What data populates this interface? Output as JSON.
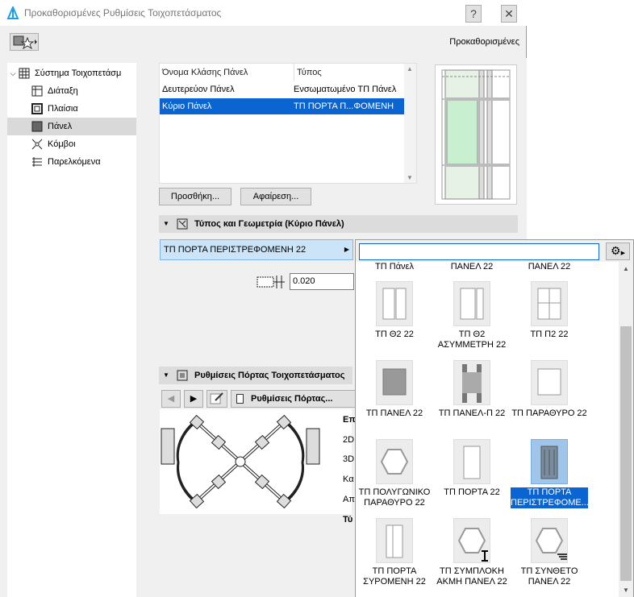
{
  "window": {
    "title": "Προκαθορισμένες Ρυθμίσεις Τοιχοπετάσματος",
    "help_label": "?",
    "close_label": "✕",
    "preset_label": "Προκαθορισμένες"
  },
  "tree": {
    "root": "Σύστημα Τοιχοπετάσμ",
    "items": [
      "Διάταξη",
      "Πλαίσια",
      "Πάνελ",
      "Κόμβοι",
      "Παρελκόμενα"
    ]
  },
  "panel_table": {
    "headers": [
      "Όνομα Κλάσης Πάνελ",
      "Τύπος"
    ],
    "rows": [
      {
        "name": "Δευτερεύον Πάνελ",
        "type": "Ενσωματωμένο ΤΠ Πάνελ"
      },
      {
        "name": "Κύριο Πάνελ",
        "type": "ΤΠ ΠΟΡΤΑ Π...ΦΟΜΕΝΗ 22"
      }
    ],
    "add_label": "Προσθήκη...",
    "remove_label": "Αφαίρεση..."
  },
  "type_section": {
    "title": "Τύπος και Γεωμετρία (Κύριο Πάνελ)",
    "selected_type": "ΤΠ ΠΟΡΤΑ ΠΕΡΙΣΤΡΕΦΟΜΕΝΗ 22",
    "thickness": "0.020"
  },
  "door_section": {
    "title": "Ρυθμίσεις Πόρτας Τοιχοπετάσματος",
    "settings_label": "Ρυθμίσεις Πόρτας...",
    "side_labels": [
      "Επ",
      "2D",
      "3D",
      "Κα",
      "Απ",
      "Τύ"
    ]
  },
  "gallery": {
    "search_value": "",
    "top_labels": [
      "ΤΠ Πάνελ",
      "ΠΑΝΕΛ 22",
      "ΠΑΝΕΛ 22"
    ],
    "items": [
      [
        "ΤΠ Θ2 22"
      ],
      [
        "ΤΠ Θ2",
        "ΑΣΥΜΜΕΤΡΗ 22"
      ],
      [
        "ΤΠ Π2 22"
      ],
      [
        "ΤΠ ΠΑΝΕΛ 22"
      ],
      [
        "ΤΠ ΠΑΝΕΛ-Π 22"
      ],
      [
        "ΤΠ ΠΑΡΑΘΥΡΟ 22"
      ],
      [
        "ΤΠ ΠΟΛΥΓΩΝΙΚΟ",
        "ΠΑΡΑΘΥΡΟ 22"
      ],
      [
        "ΤΠ ΠΟΡΤΑ 22"
      ],
      [
        "ΤΠ ΠΟΡΤΑ",
        "ΠΕΡΙΣΤΡΕΦΟΜΕ..."
      ],
      [
        "ΤΠ ΠΟΡΤΑ",
        "ΣΥΡΟΜΕΝΗ 22"
      ],
      [
        "ΤΠ ΣΥΜΠΛΟΚΗ",
        "ΑΚΜΗ ΠΑΝΕΛ 22"
      ],
      [
        "ΤΠ ΣΥΝΘΕΤΟ",
        "ΠΑΝΕΛ 22"
      ]
    ]
  },
  "colors": {
    "accent": "#0a64d2",
    "selection_light": "#cce4f7"
  }
}
